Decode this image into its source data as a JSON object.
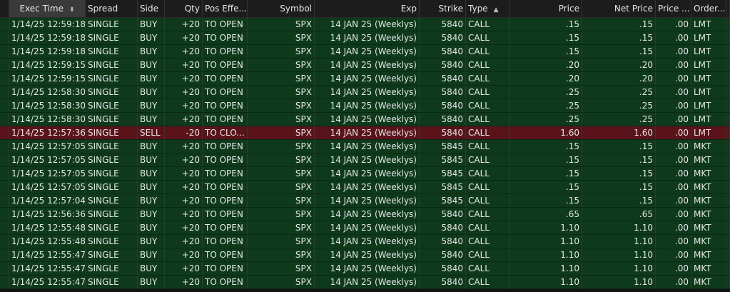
{
  "columns": [
    {
      "key": "exec_time",
      "label": "Exec Time",
      "align": "c",
      "sort": "⬍"
    },
    {
      "key": "spread",
      "label": "Spread",
      "align": "l"
    },
    {
      "key": "side",
      "label": "Side",
      "align": "l"
    },
    {
      "key": "qty",
      "label": "Qty",
      "align": "r"
    },
    {
      "key": "pos_effect",
      "label": "Pos Effe...",
      "align": "l"
    },
    {
      "key": "symbol",
      "label": "Symbol",
      "align": "l"
    },
    {
      "key": "exp",
      "label": "Exp",
      "align": "r"
    },
    {
      "key": "strike",
      "label": "Strike",
      "align": "r"
    },
    {
      "key": "type",
      "label": "Type",
      "align": "l",
      "sort": "▲"
    },
    {
      "key": "price",
      "label": "Price",
      "align": "r"
    },
    {
      "key": "net_price",
      "label": "Net Price",
      "align": "r"
    },
    {
      "key": "price_impr",
      "label": "Price ...",
      "align": "r"
    },
    {
      "key": "order_type",
      "label": "Order...",
      "align": "l"
    }
  ],
  "colors": {
    "buy_row": "#0e3a1b",
    "sell_row": "#5a1319"
  },
  "rows": [
    [
      "1/14/25 12:59:18",
      "SINGLE",
      "BUY",
      "+20",
      "TO OPEN",
      "SPX",
      "14 JAN 25 (Weeklys)",
      "5840",
      "CALL",
      ".15",
      ".15",
      ".00",
      "LMT"
    ],
    [
      "1/14/25 12:59:18",
      "SINGLE",
      "BUY",
      "+20",
      "TO OPEN",
      "SPX",
      "14 JAN 25 (Weeklys)",
      "5840",
      "CALL",
      ".15",
      ".15",
      ".00",
      "LMT"
    ],
    [
      "1/14/25 12:59:18",
      "SINGLE",
      "BUY",
      "+20",
      "TO OPEN",
      "SPX",
      "14 JAN 25 (Weeklys)",
      "5840",
      "CALL",
      ".15",
      ".15",
      ".00",
      "LMT"
    ],
    [
      "1/14/25 12:59:15",
      "SINGLE",
      "BUY",
      "+20",
      "TO OPEN",
      "SPX",
      "14 JAN 25 (Weeklys)",
      "5840",
      "CALL",
      ".20",
      ".20",
      ".00",
      "LMT"
    ],
    [
      "1/14/25 12:59:15",
      "SINGLE",
      "BUY",
      "+20",
      "TO OPEN",
      "SPX",
      "14 JAN 25 (Weeklys)",
      "5840",
      "CALL",
      ".20",
      ".20",
      ".00",
      "LMT"
    ],
    [
      "1/14/25 12:58:30",
      "SINGLE",
      "BUY",
      "+20",
      "TO OPEN",
      "SPX",
      "14 JAN 25 (Weeklys)",
      "5840",
      "CALL",
      ".25",
      ".25",
      ".00",
      "LMT"
    ],
    [
      "1/14/25 12:58:30",
      "SINGLE",
      "BUY",
      "+20",
      "TO OPEN",
      "SPX",
      "14 JAN 25 (Weeklys)",
      "5840",
      "CALL",
      ".25",
      ".25",
      ".00",
      "LMT"
    ],
    [
      "1/14/25 12:58:30",
      "SINGLE",
      "BUY",
      "+20",
      "TO OPEN",
      "SPX",
      "14 JAN 25 (Weeklys)",
      "5840",
      "CALL",
      ".25",
      ".25",
      ".00",
      "LMT"
    ],
    [
      "1/14/25 12:57:36",
      "SINGLE",
      "SELL",
      "-20",
      "TO CLO...",
      "SPX",
      "14 JAN 25 (Weeklys)",
      "5840",
      "CALL",
      "1.60",
      "1.60",
      ".00",
      "LMT"
    ],
    [
      "1/14/25 12:57:05",
      "SINGLE",
      "BUY",
      "+20",
      "TO OPEN",
      "SPX",
      "14 JAN 25 (Weeklys)",
      "5845",
      "CALL",
      ".15",
      ".15",
      ".00",
      "MKT"
    ],
    [
      "1/14/25 12:57:05",
      "SINGLE",
      "BUY",
      "+20",
      "TO OPEN",
      "SPX",
      "14 JAN 25 (Weeklys)",
      "5845",
      "CALL",
      ".15",
      ".15",
      ".00",
      "MKT"
    ],
    [
      "1/14/25 12:57:05",
      "SINGLE",
      "BUY",
      "+20",
      "TO OPEN",
      "SPX",
      "14 JAN 25 (Weeklys)",
      "5845",
      "CALL",
      ".15",
      ".15",
      ".00",
      "MKT"
    ],
    [
      "1/14/25 12:57:05",
      "SINGLE",
      "BUY",
      "+20",
      "TO OPEN",
      "SPX",
      "14 JAN 25 (Weeklys)",
      "5845",
      "CALL",
      ".15",
      ".15",
      ".00",
      "MKT"
    ],
    [
      "1/14/25 12:57:04",
      "SINGLE",
      "BUY",
      "+20",
      "TO OPEN",
      "SPX",
      "14 JAN 25 (Weeklys)",
      "5845",
      "CALL",
      ".15",
      ".15",
      ".00",
      "MKT"
    ],
    [
      "1/14/25 12:56:36",
      "SINGLE",
      "BUY",
      "+20",
      "TO OPEN",
      "SPX",
      "14 JAN 25 (Weeklys)",
      "5840",
      "CALL",
      ".65",
      ".65",
      ".00",
      "MKT"
    ],
    [
      "1/14/25 12:55:48",
      "SINGLE",
      "BUY",
      "+20",
      "TO OPEN",
      "SPX",
      "14 JAN 25 (Weeklys)",
      "5840",
      "CALL",
      "1.10",
      "1.10",
      ".00",
      "MKT"
    ],
    [
      "1/14/25 12:55:48",
      "SINGLE",
      "BUY",
      "+20",
      "TO OPEN",
      "SPX",
      "14 JAN 25 (Weeklys)",
      "5840",
      "CALL",
      "1.10",
      "1.10",
      ".00",
      "MKT"
    ],
    [
      "1/14/25 12:55:47",
      "SINGLE",
      "BUY",
      "+20",
      "TO OPEN",
      "SPX",
      "14 JAN 25 (Weeklys)",
      "5840",
      "CALL",
      "1.10",
      "1.10",
      ".00",
      "MKT"
    ],
    [
      "1/14/25 12:55:47",
      "SINGLE",
      "BUY",
      "+20",
      "TO OPEN",
      "SPX",
      "14 JAN 25 (Weeklys)",
      "5840",
      "CALL",
      "1.10",
      "1.10",
      ".00",
      "MKT"
    ],
    [
      "1/14/25 12:55:47",
      "SINGLE",
      "BUY",
      "+20",
      "TO OPEN",
      "SPX",
      "14 JAN 25 (Weeklys)",
      "5840",
      "CALL",
      "1.10",
      "1.10",
      ".00",
      "MKT"
    ]
  ]
}
